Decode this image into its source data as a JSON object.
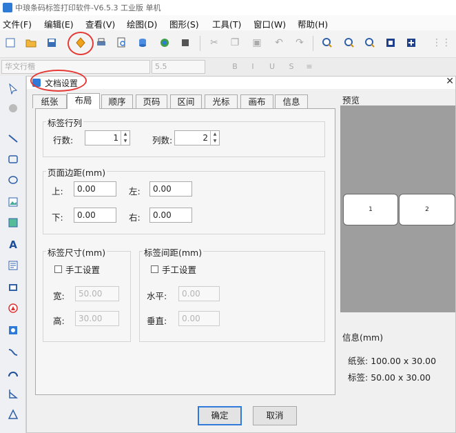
{
  "app": {
    "title": "中琅条码标签打印软件-V6.5.3 工业版 单机"
  },
  "menu": [
    "文件(F)",
    "编辑(E)",
    "查看(V)",
    "绘图(D)",
    "图形(S)",
    "工具(T)",
    "窗口(W)",
    "帮助(H)"
  ],
  "format_bar": {
    "font_name": "华文行楷",
    "font_size": "5.5"
  },
  "toolbar_icons": [
    "new-icon",
    "open-icon",
    "save-icon",
    "document-settings-icon",
    "print-icon",
    "print-preview-icon",
    "database-icon",
    "web-icon",
    "stop-icon",
    "cut-icon",
    "copy-icon",
    "paste-icon",
    "undo-icon",
    "redo-icon",
    "zoom-in-icon",
    "zoom-out-icon",
    "zoom-icon",
    "fit-icon",
    "actual-size-icon",
    "grip-icon"
  ],
  "left_tools": [
    "select-icon",
    "pan-icon",
    "line-icon",
    "rectangle-icon",
    "ellipse-icon",
    "image-icon",
    "image-alt-icon",
    "text-icon",
    "rich-text-icon",
    "barcode-icon",
    "qrcode-icon",
    "ellipse-shape-icon",
    "curve-icon",
    "arc-icon",
    "polyline-icon",
    "triangle-icon"
  ],
  "dialog": {
    "title": "文档设置",
    "tabs": [
      "纸张",
      "布局",
      "顺序",
      "页码",
      "区间",
      "光标",
      "画布",
      "信息"
    ],
    "active_tab": "布局",
    "layout": {
      "rows_cols": {
        "title": "标签行列",
        "rows_label": "行数:",
        "rows_value": "1",
        "cols_label": "列数:",
        "cols_value": "2"
      },
      "margins": {
        "title": "页面边距(mm)",
        "top_label": "上:",
        "top_value": "0.00",
        "left_label": "左:",
        "left_value": "0.00",
        "bottom_label": "下:",
        "bottom_value": "0.00",
        "right_label": "右:",
        "right_value": "0.00"
      },
      "label_size": {
        "title": "标签尺寸(mm)",
        "manual_label": "手工设置",
        "width_label": "宽:",
        "width_value": "50.00",
        "height_label": "高:",
        "height_value": "30.00"
      },
      "label_spacing": {
        "title": "标签间距(mm)",
        "manual_label": "手工设置",
        "h_label": "水平:",
        "h_value": "0.00",
        "v_label": "垂直:",
        "v_value": "0.00"
      }
    },
    "preview": {
      "title": "预览",
      "labels": [
        "1",
        "2"
      ]
    },
    "info": {
      "title": "信息(mm)",
      "paper_label": "纸张:",
      "paper_value": "100.00 x 30.00",
      "label_label": "标签:",
      "label_value": "50.00 x 30.00"
    },
    "ok": "确定",
    "cancel": "取消"
  }
}
